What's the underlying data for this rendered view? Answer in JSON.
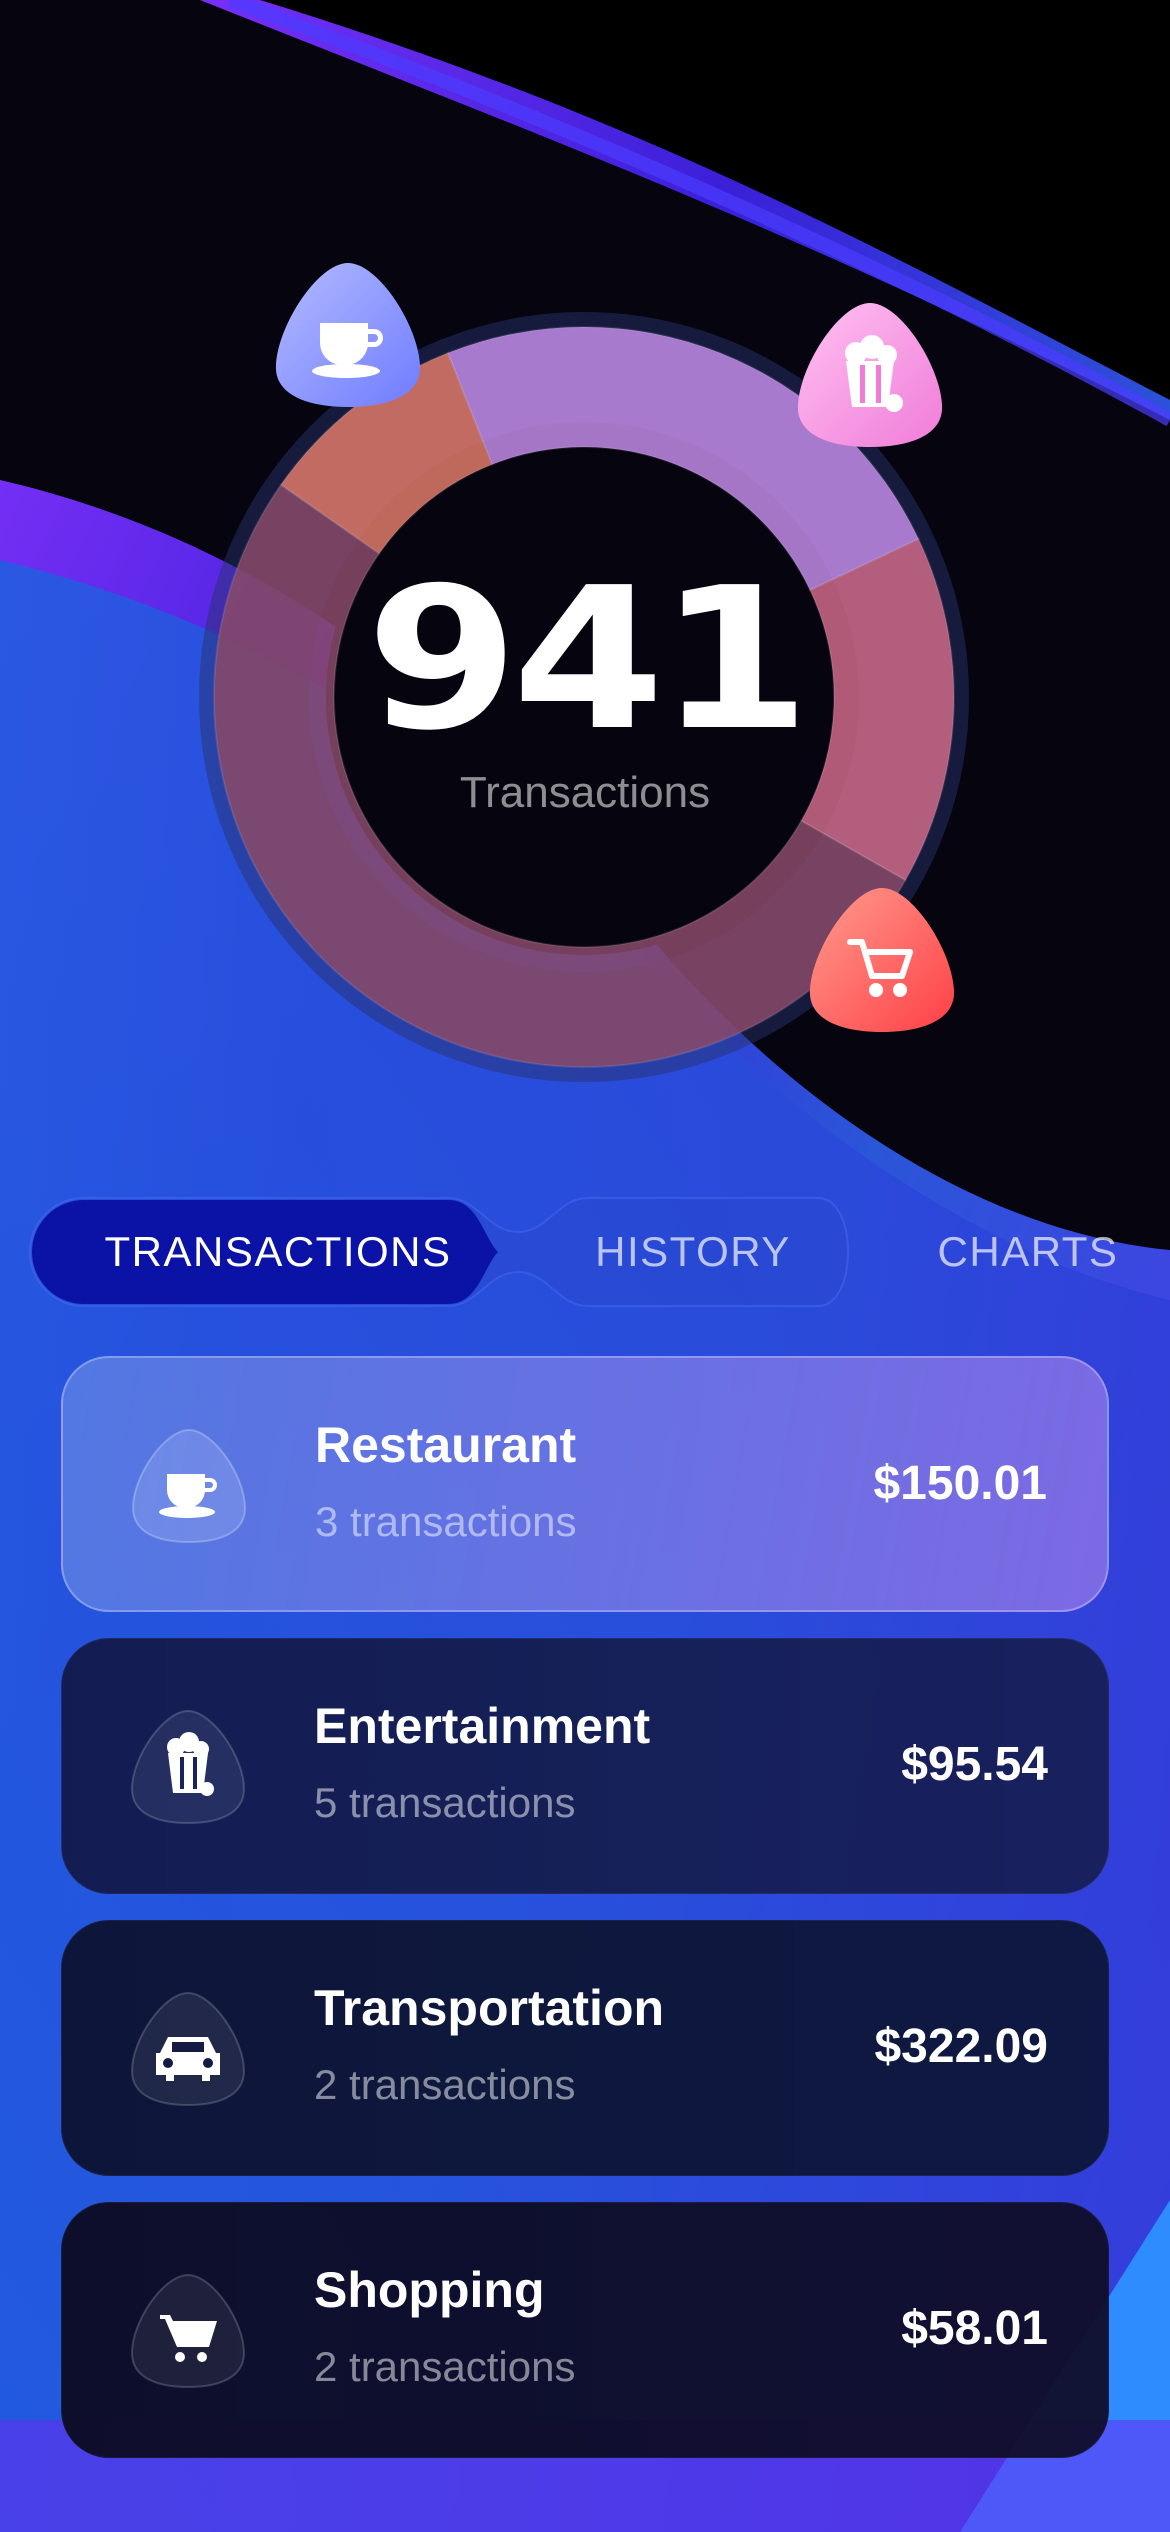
{
  "summary": {
    "total": "941",
    "caption": "Transactions"
  },
  "chart_data": {
    "type": "pie",
    "style": "donut",
    "center_value": "941",
    "center_label": "Transactions",
    "categories": [
      "Restaurant",
      "Entertainment",
      "Transportation",
      "Shopping"
    ],
    "series": [
      {
        "values": [
          150.01,
          95.54,
          322.09,
          58.01
        ]
      }
    ],
    "colors": [
      "#c18be6",
      "#d06a8a",
      "#8a4a6a",
      "#e07a6a"
    ],
    "legend": "none"
  },
  "tabs": [
    {
      "label": "TRANSACTIONS",
      "active": true
    },
    {
      "label": "HISTORY",
      "active": false
    },
    {
      "label": "CHARTS",
      "active": false
    }
  ],
  "categories": [
    {
      "title": "Restaurant",
      "subtitle": "3 transactions",
      "amount": "$150.01",
      "icon": "coffee-cup-icon"
    },
    {
      "title": "Entertainment",
      "subtitle": "5 transactions",
      "amount": "$95.54",
      "icon": "popcorn-icon"
    },
    {
      "title": "Transportation",
      "subtitle": "2 transactions",
      "amount": "$322.09",
      "icon": "car-icon"
    },
    {
      "title": "Shopping",
      "subtitle": "2 transactions",
      "amount": "$58.01",
      "icon": "cart-icon"
    }
  ],
  "colors": {
    "accent_tab": "#0b12a6",
    "bubble_restaurant": "#8f9cff",
    "bubble_entertainment": "#f7a6e8",
    "bubble_shopping": "#ff5f5a"
  }
}
